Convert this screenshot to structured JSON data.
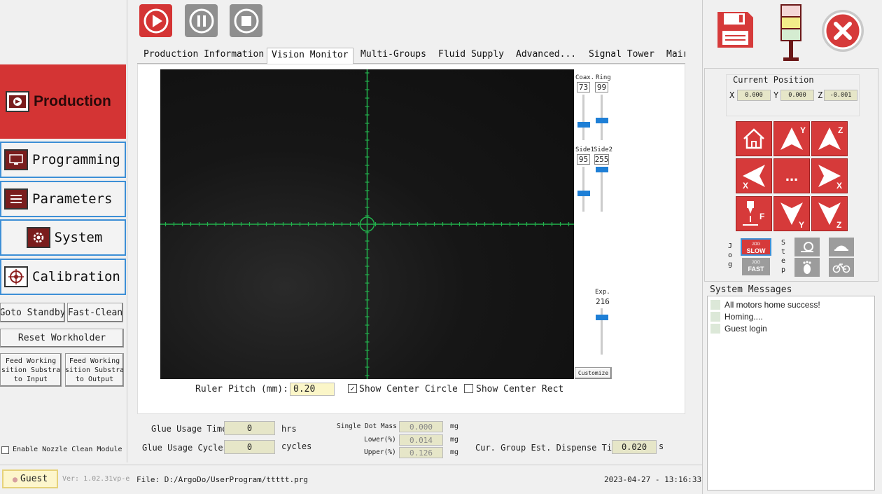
{
  "toolbar": {
    "play_icon": "play-icon",
    "pause_icon": "pause-icon",
    "stop_icon": "stop-icon"
  },
  "nav": {
    "production": "Production",
    "programming": "Programming",
    "parameters": "Parameters",
    "system": "System",
    "calibration": "Calibration"
  },
  "left_buttons": {
    "goto_standby": "Goto Standby",
    "fast_clean": "Fast-Clean",
    "reset_workholder": "Reset Workholder",
    "feed_input": [
      "Feed Working",
      "sition Substra",
      "to Input"
    ],
    "feed_output": [
      "Feed Working",
      "sition Substra",
      "to Output"
    ],
    "enable_nozzle": "Enable Nozzle Clean Module"
  },
  "tabs": [
    "Production Information",
    "Vision Monitor",
    "Multi-Groups",
    "Fluid Supply",
    "Advanced...",
    "Signal Tower",
    "Mair"
  ],
  "vision": {
    "coax_label": "Coax.",
    "coax_value": "73",
    "ring_label": "Ring",
    "ring_value": "99",
    "side1_label": "Side1",
    "side1_value": "95",
    "side2_label": "Side2",
    "side2_value": "255",
    "exp_label": "Exp.",
    "exp_value": "216",
    "customize": "Customize",
    "ruler_label": "Ruler Pitch (mm):",
    "ruler_value": "0.20",
    "show_center_circle": "Show Center Circle",
    "show_center_rect": "Show Center Rect"
  },
  "glue": {
    "usage_time_label": "Glue Usage Time:",
    "usage_time_value": "0",
    "usage_time_unit": "hrs",
    "usage_cycles_label": "Glue Usage Cycles:",
    "usage_cycles_value": "0",
    "usage_cycles_unit": "cycles",
    "single_dot_label": "Single Dot Mass",
    "single_dot_value": "0.000",
    "lower_label": "Lower(%)",
    "lower_value": "0.014",
    "upper_label": "Upper(%)",
    "upper_value": "0.126",
    "mg": "mg",
    "est_time_label": "Cur. Group Est. Dispense Time:",
    "est_time_value": "0.020",
    "est_time_unit": "s"
  },
  "position": {
    "title": "Current Position",
    "x_label": "X",
    "x": "0.000",
    "y_label": "Y",
    "y": "0.000",
    "z_label": "Z",
    "z": "-0.001"
  },
  "jog": {
    "jog_label": "J o g",
    "step_label": "S t e p",
    "slow": "SLOW",
    "fast": "FAST",
    "jog_small": "JOG",
    "x": "X",
    "y": "Y",
    "z": "Z",
    "f": "F",
    "dots": "..."
  },
  "messages": {
    "title": "System Messages",
    "items": [
      "All motors home success!",
      "Homing....",
      "Guest login"
    ]
  },
  "status": {
    "user": "Guest",
    "version": "Ver: 1.02.31vp-e",
    "file": "File: D:/ArgoDo/UserProgram/ttttt.prg",
    "datetime": "2023-04-27 - 13:16:33"
  },
  "colors": {
    "accent_red": "#d63a3a",
    "nav_border": "#3d8fd6",
    "crosshair": "#22b14c",
    "slider": "#1e7fd6"
  }
}
